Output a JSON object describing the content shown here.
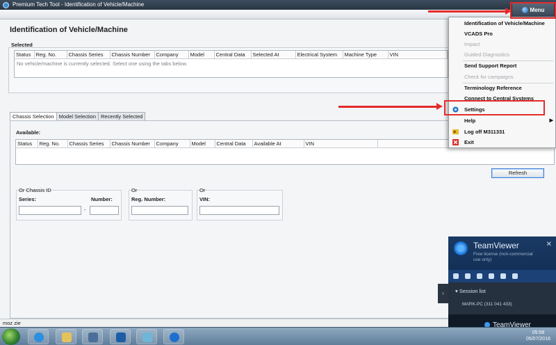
{
  "window": {
    "title": "Premium Tech Tool - Identification of Vehicle/Machine",
    "menu_label": "Menu"
  },
  "page": {
    "title": "Identification of Vehicle/Machine",
    "selected": {
      "label": "Selected",
      "columns": [
        "Status",
        "Reg. No.",
        "Chassis Series",
        "Chassis Number",
        "Company",
        "Model",
        "Central Data",
        "Selected At",
        "Electrical System",
        "Machine Type",
        "VIN"
      ],
      "empty_message": "No vehicle/machine is currently selected. Select one using the tabs below."
    },
    "tabs": [
      {
        "label": "Chassis Selection",
        "active": true
      },
      {
        "label": "Model Selection",
        "active": false
      },
      {
        "label": "Recently Selected",
        "active": false
      }
    ],
    "available": {
      "label": "Available:",
      "columns": [
        "Status",
        "Reg. No.",
        "Chassis Series",
        "Chassis Number",
        "Company",
        "Model",
        "Central Data",
        "Available At",
        "VIN"
      ]
    },
    "refresh_label": "Refresh",
    "chassis_group": {
      "title": "Or Chassis ID",
      "series_label": "Series:",
      "number_label": "Number:",
      "dash": "-"
    },
    "reg_group": {
      "title": "Or",
      "label": "Reg. Number:"
    },
    "vin_group": {
      "title": "Or",
      "label": "VIN:"
    }
  },
  "menu": {
    "items": [
      {
        "label": "Identification of Vehicle/Machine",
        "enabled": true
      },
      {
        "label": "VCADS Pro",
        "enabled": true
      },
      {
        "label": "Impact",
        "enabled": false
      },
      {
        "label": "Guided Diagnostics",
        "enabled": false
      },
      {
        "label": "Send Support Report",
        "enabled": true
      },
      {
        "label": "Check for campaigns",
        "enabled": false
      },
      {
        "label": "Terminology Reference",
        "enabled": true
      },
      {
        "label": "Connect to Central Systems",
        "enabled": true
      },
      {
        "label": "Settings",
        "enabled": true,
        "icon": "settings-globe-icon"
      },
      {
        "label": "Help",
        "enabled": true,
        "submenu": true
      },
      {
        "label": "Log off M311331",
        "enabled": true,
        "icon": "key-icon"
      },
      {
        "label": "Exit",
        "enabled": true,
        "icon": "exit-x-icon"
      }
    ]
  },
  "teamviewer": {
    "title": "TeamViewer",
    "subtitle": "Free license (non-commercial use only)",
    "session_list_label": "Session list",
    "session_item": "MARK-PC (311 041 433)",
    "footer_brand": "TeamViewer"
  },
  "statusbar": {
    "text": "moz zie"
  },
  "taskbar": {
    "time": "05:58",
    "date": "05/07/2016"
  },
  "colors": {
    "annotation_red": "#e52b2b",
    "menu_bar": "#3a4756",
    "teamviewer_blue": "#1b3a64"
  }
}
